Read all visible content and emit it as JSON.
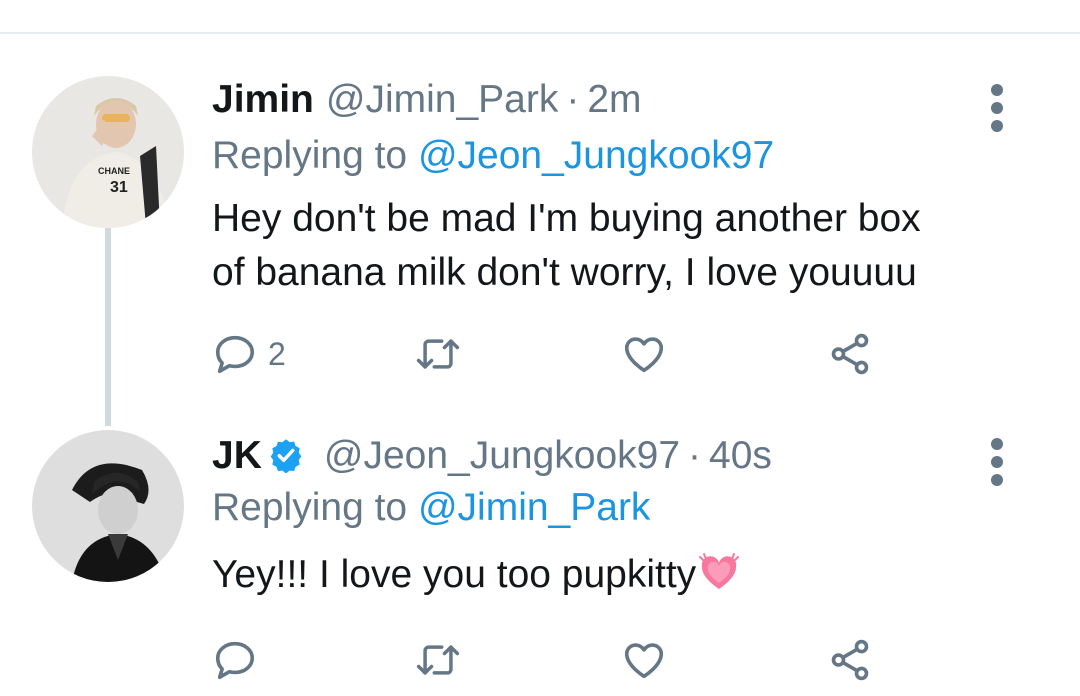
{
  "thread": [
    {
      "display_name": "Jimin",
      "handle": "@Jimin_Park",
      "separator": "·",
      "timestamp": "2m",
      "reply_prefix": "Replying to ",
      "reply_mention": "@Jeon_Jungkook97",
      "text_line1": "Hey don't be mad I'm buying another box",
      "text_line2": "of banana milk don't worry,  I love youuuu",
      "reply_count": "2",
      "verified": false
    },
    {
      "display_name": "JK",
      "handle": "@Jeon_Jungkook97",
      "separator": "·",
      "timestamp": "40s",
      "reply_prefix": "Replying to ",
      "reply_mention": "@Jimin_Park",
      "text_line1": "Yey!!!  I love you too pupkitty",
      "text_emoji": "growing-heart-emoji",
      "reply_count": "",
      "verified": true
    }
  ],
  "colors": {
    "text_primary": "#14171a",
    "text_secondary": "#657786",
    "link": "#1b95e0",
    "verified": "#1da1f2",
    "divider": "#e6ecf0",
    "thread_line": "#cfd9de"
  },
  "icons": [
    "reply-icon",
    "retweet-icon",
    "like-icon",
    "share-icon",
    "more-options-icon",
    "verified-badge-icon"
  ]
}
